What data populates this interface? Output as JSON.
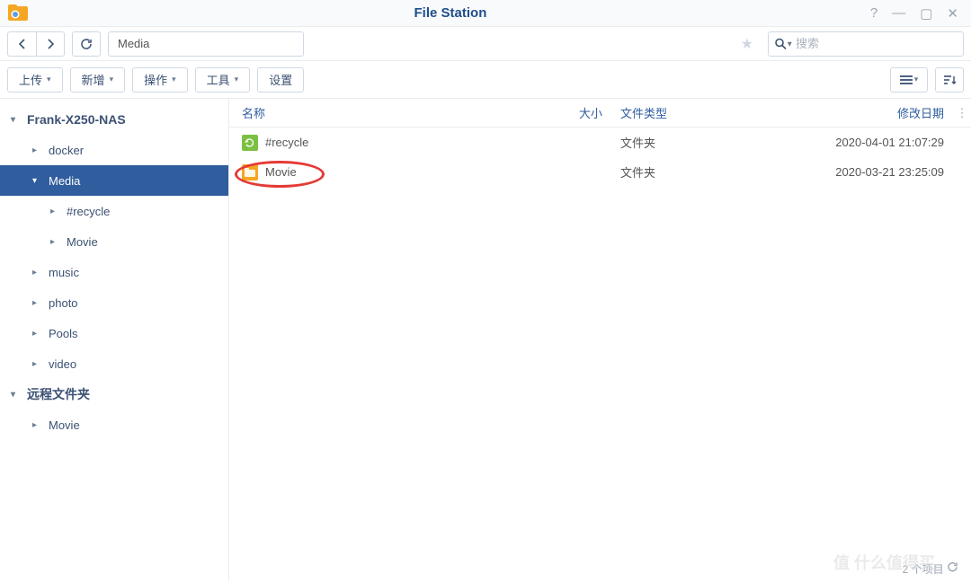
{
  "window": {
    "title": "File Station"
  },
  "nav": {
    "path": "Media",
    "search_placeholder": "搜索"
  },
  "toolbar": {
    "upload": "上传",
    "create": "新增",
    "action": "操作",
    "tool": "工具",
    "settings": "设置"
  },
  "sidebar": {
    "root": "Frank-X250-NAS",
    "items": [
      {
        "label": "docker"
      },
      {
        "label": "Media"
      },
      {
        "label": "#recycle"
      },
      {
        "label": "Movie"
      },
      {
        "label": "music"
      },
      {
        "label": "photo"
      },
      {
        "label": "Pools"
      },
      {
        "label": "video"
      }
    ],
    "remote_root": "远程文件夹",
    "remote_items": [
      {
        "label": "Movie"
      }
    ]
  },
  "columns": {
    "name": "名称",
    "size": "大小",
    "type": "文件类型",
    "date": "修改日期"
  },
  "files": [
    {
      "name": "#recycle",
      "type": "文件夹",
      "date": "2020-04-01 21:07:29",
      "icon": "recycle"
    },
    {
      "name": "Movie",
      "type": "文件夹",
      "date": "2020-03-21 23:25:09",
      "icon": "folder"
    }
  ],
  "status": {
    "count": "2 个项目"
  }
}
